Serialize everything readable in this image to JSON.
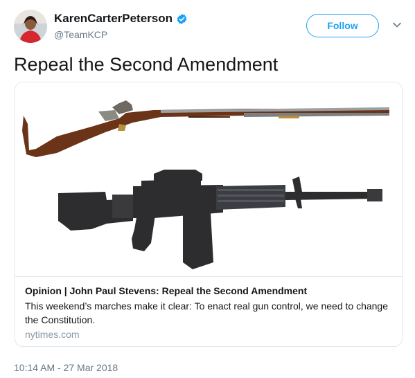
{
  "author": {
    "display_name": "KarenCarterPeterson",
    "handle": "@TeamKCP",
    "verified": true
  },
  "actions": {
    "follow_label": "Follow"
  },
  "tweet": {
    "text": "Repeal the Second Amendment",
    "timestamp": "10:14 AM - 27 Mar 2018"
  },
  "card": {
    "title": "Opinion | John Paul Stevens: Repeal the Second Amendment",
    "description": "This weekend’s marches make it clear: To enact real gun control, we need to change the Constitution.",
    "domain": "nytimes.com",
    "image_content": [
      "musket",
      "assault-rifle"
    ]
  },
  "colors": {
    "accent": "#1da1f2",
    "text_primary": "#14171a",
    "text_secondary": "#657786",
    "border": "#e1e8ed"
  }
}
